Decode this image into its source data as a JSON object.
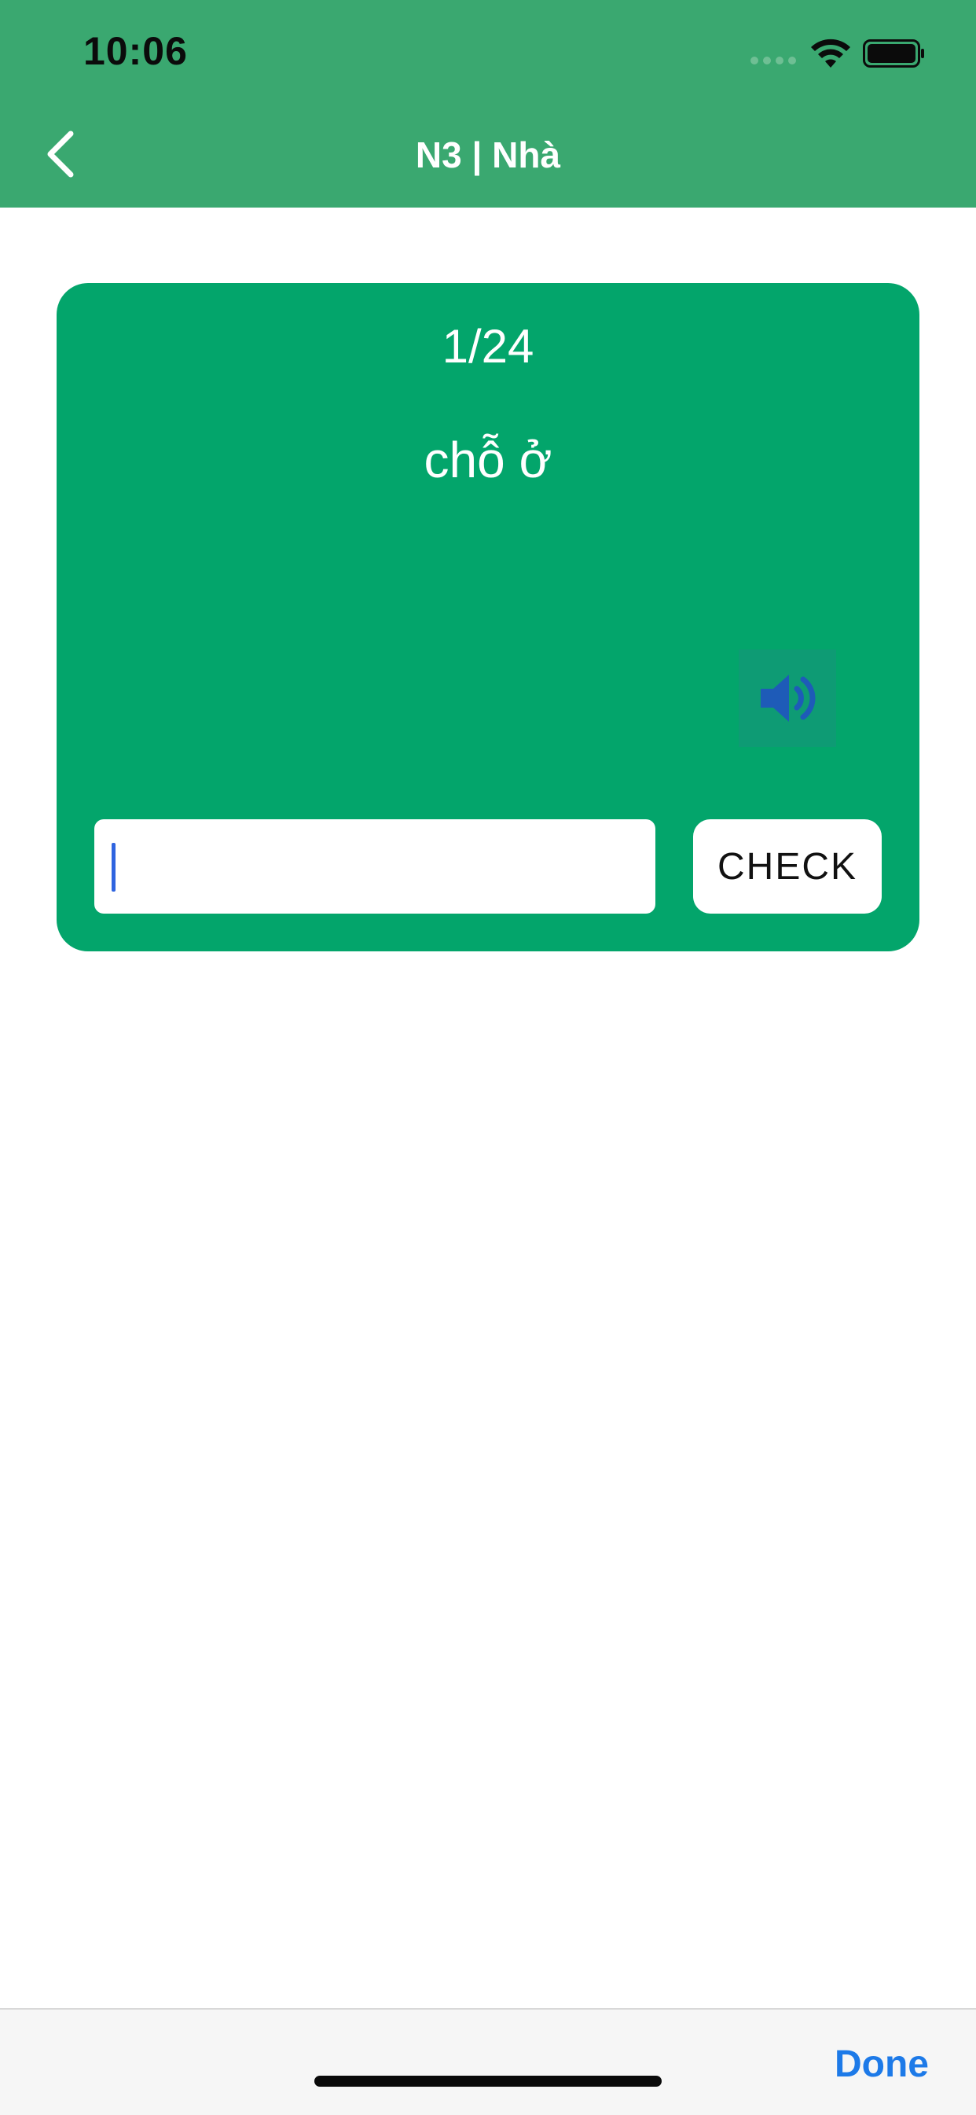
{
  "status_bar": {
    "time": "10:06"
  },
  "nav": {
    "title": "N3 | Nhà"
  },
  "card": {
    "progress": "1/24",
    "word": "chỗ ở",
    "answer_value": "",
    "check_label": "CHECK"
  },
  "keyboard_toolbar": {
    "done_label": "Done"
  },
  "colors": {
    "header": "#3aa870",
    "card": "#03a56b",
    "speaker_icon": "#1e5bb8",
    "done": "#1d7ae8"
  },
  "icons": {
    "back": "chevron-left-icon",
    "speaker": "speaker-icon",
    "wifi": "wifi-icon",
    "battery": "battery-icon"
  }
}
